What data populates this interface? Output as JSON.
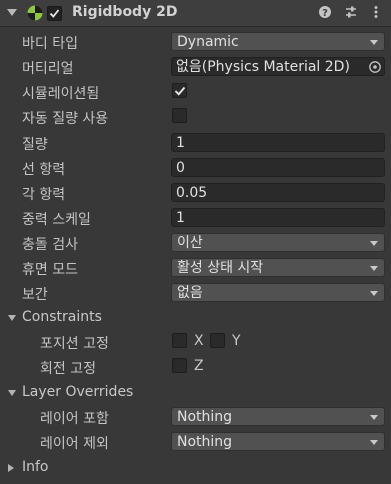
{
  "header": {
    "title": "Rigidbody 2D",
    "icons": [
      "collapse-arrow-icon",
      "rigidbody2d-icon",
      "enable-checkbox",
      "help-icon",
      "preset-icon",
      "more-options-icon"
    ],
    "accent": "#8dc63f"
  },
  "properties": [
    {
      "label": "바디 타입",
      "kind": "dropdown",
      "value": "Dynamic"
    },
    {
      "label": "머티리얼",
      "kind": "object",
      "value": "없음(Physics Material 2D)"
    },
    {
      "label": "시뮬레이션됨",
      "kind": "checkbox",
      "checked": true
    },
    {
      "label": "자동 질량 사용",
      "kind": "checkbox",
      "checked": false
    },
    {
      "label": "질량",
      "kind": "field",
      "value": "1"
    },
    {
      "label": "선 항력",
      "kind": "field",
      "value": "0"
    },
    {
      "label": "각 항력",
      "kind": "field",
      "value": "0.05"
    },
    {
      "label": "중력 스케일",
      "kind": "field",
      "value": "1"
    },
    {
      "label": "충돌 검사",
      "kind": "dropdown",
      "value": "이산"
    },
    {
      "label": "휴면 모드",
      "kind": "dropdown",
      "value": "활성 상태 시작"
    },
    {
      "label": "보간",
      "kind": "dropdown",
      "value": "없음"
    }
  ],
  "constraints": {
    "title": "Constraints",
    "position": {
      "label": "포지션 고정",
      "x_label": "X",
      "y_label": "Y",
      "x": false,
      "y": false
    },
    "rotation": {
      "label": "회전 고정",
      "z_label": "Z",
      "z": false
    }
  },
  "layer_overrides": {
    "title": "Layer Overrides",
    "include": {
      "label": "레이어 포함",
      "value": "Nothing"
    },
    "exclude": {
      "label": "레이어 제외",
      "value": "Nothing"
    }
  },
  "info": {
    "title": "Info"
  }
}
